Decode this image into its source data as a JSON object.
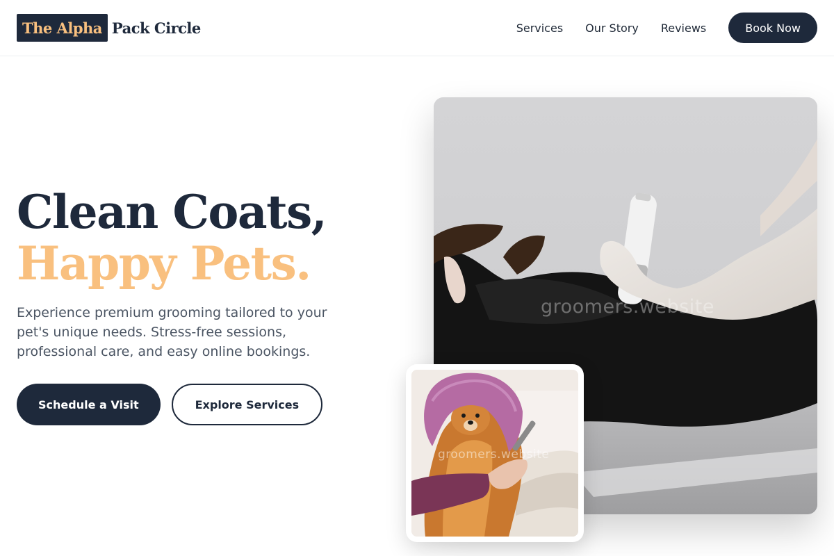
{
  "header": {
    "logo_badge": "The Alpha",
    "logo_text": "Pack Circle",
    "nav": [
      "Services",
      "Our Story",
      "Reviews"
    ],
    "book_label": "Book Now"
  },
  "hero": {
    "title_line1": "Clean Coats,",
    "title_line2": "Happy Pets.",
    "description": "Experience premium grooming tailored to your pet's unique needs. Stress-free sessions, professional care, and easy online bookings.",
    "primary_cta": "Schedule a Visit",
    "secondary_cta": "Explore Services"
  },
  "images": {
    "main_watermark": "groomers.website",
    "small_watermark": "groomers.website",
    "main_icon": "dog-grooming-clipper-photo",
    "small_icon": "dog-towel-photo"
  },
  "colors": {
    "navy": "#1e293b",
    "accent": "#f9c07f",
    "body_text": "#4b5563"
  }
}
